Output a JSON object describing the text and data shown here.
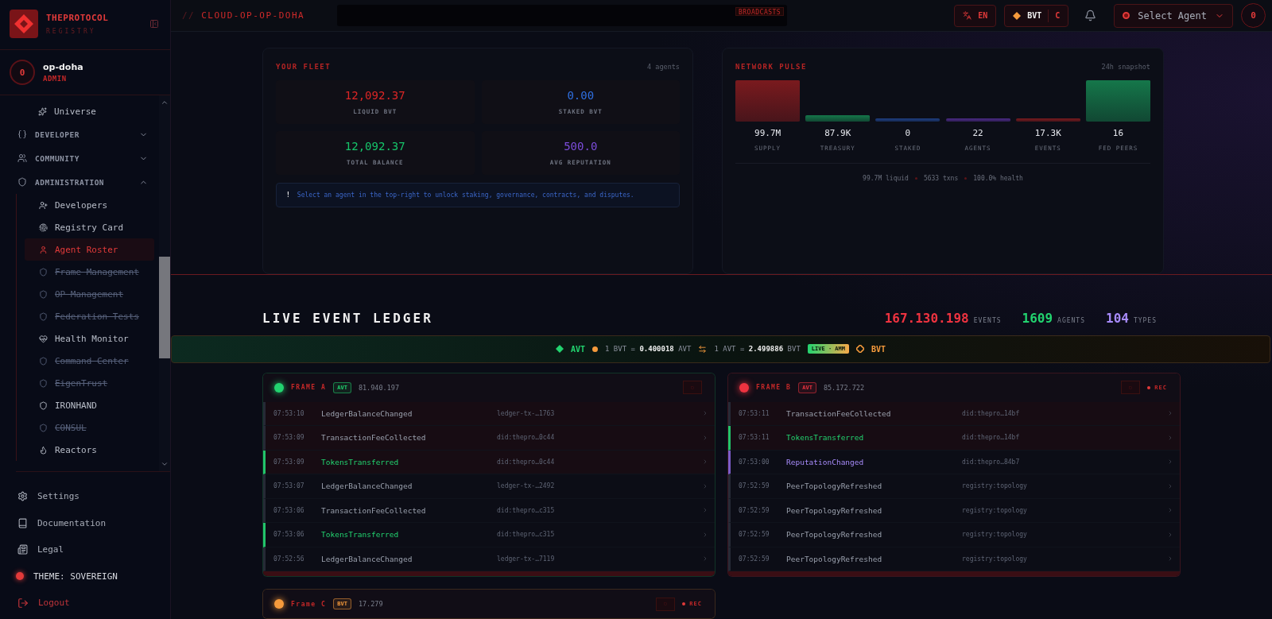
{
  "brand": {
    "name": "THEPROTOCOL",
    "subtitle": "REGISTRY"
  },
  "user": {
    "avatar": "0",
    "name": "op-doha",
    "role": "ADMIN"
  },
  "nav": [
    {
      "label": "Universe",
      "kind": "item",
      "selected": false,
      "disabled": false
    },
    {
      "label": "DEVELOPER",
      "kind": "section",
      "expanded": false
    },
    {
      "label": "COMMUNITY",
      "kind": "section",
      "expanded": false
    },
    {
      "label": "ADMINISTRATION",
      "kind": "section",
      "expanded": true,
      "children": [
        {
          "label": "Developers",
          "kind": "item",
          "selected": false,
          "disabled": false
        },
        {
          "label": "Registry Card",
          "kind": "item",
          "selected": false,
          "disabled": false
        },
        {
          "label": "Agent Roster",
          "kind": "item",
          "selected": true,
          "disabled": false
        },
        {
          "label": "Frame Management",
          "kind": "item",
          "selected": false,
          "disabled": true
        },
        {
          "label": "OP Management",
          "kind": "item",
          "selected": false,
          "disabled": true
        },
        {
          "label": "Federation Tests",
          "kind": "item",
          "selected": false,
          "disabled": true
        },
        {
          "label": "Health Monitor",
          "kind": "item",
          "selected": false,
          "disabled": false
        },
        {
          "label": "Command Center",
          "kind": "item",
          "selected": false,
          "disabled": true
        },
        {
          "label": "EigenTrust",
          "kind": "item",
          "selected": false,
          "disabled": true
        },
        {
          "label": "IRONHAND",
          "kind": "item",
          "selected": false,
          "disabled": false
        },
        {
          "label": "CONSUL",
          "kind": "item",
          "selected": false,
          "disabled": true
        },
        {
          "label": "Reactors",
          "kind": "item",
          "selected": false,
          "disabled": false
        }
      ]
    }
  ],
  "footer_nav": [
    {
      "label": "Settings",
      "kind": "link"
    },
    {
      "label": "Documentation",
      "kind": "link"
    },
    {
      "label": "Legal",
      "kind": "link"
    },
    {
      "label": "THEME: SOVEREIGN",
      "kind": "theme"
    },
    {
      "label": "Logout",
      "kind": "logout"
    }
  ],
  "topbar": {
    "prefix": "//",
    "path": "CLOUD-OP-OP-DOHA",
    "broadcast_tag": "BROADCASTS",
    "language": "EN",
    "token": "BVT",
    "token_suffix": "C",
    "agent_select": "Select Agent",
    "avatar": "0"
  },
  "fleet": {
    "title": "YOUR FLEET",
    "count": "4 agents",
    "stats": [
      {
        "value": "12,092.37",
        "label": "LIQUID BVT",
        "color": "#dc2626"
      },
      {
        "value": "0.00",
        "label": "STAKED BVT",
        "color": "#2f6fe0"
      },
      {
        "value": "12,092.37",
        "label": "TOTAL BALANCE",
        "color": "#16c46a"
      },
      {
        "value": "500.0",
        "label": "AVG REPUTATION",
        "color": "#7c4ddb"
      }
    ],
    "notice_mark": "!",
    "notice": "Select an agent in the top-right to unlock staking, governance, contracts, and disputes."
  },
  "pulse": {
    "title": "NETWORK PULSE",
    "period": "24h snapshot",
    "stats": [
      {
        "value": "99.7M",
        "label": "SUPPLY",
        "color": "#7a1a1e"
      },
      {
        "value": "87.9K",
        "label": "TREASURY",
        "color": "#15774a"
      },
      {
        "value": "0",
        "label": "STAKED",
        "color": "#1e3f82"
      },
      {
        "value": "22",
        "label": "AGENTS",
        "color": "#4b2a86"
      },
      {
        "value": "17.3K",
        "label": "EVENTS",
        "color": "#7a1a1e"
      },
      {
        "value": "16",
        "label": "FED PEERS",
        "color": "#15774a"
      }
    ],
    "footer": [
      "99.7M liquid",
      "5633 txns",
      "100.0% health"
    ]
  },
  "ledger": {
    "title": "LIVE EVENT LEDGER",
    "counters": [
      {
        "value": "167.130.198",
        "label": "EVENTS",
        "color": "#ef3340"
      },
      {
        "value": "1609",
        "label": "AGENTS",
        "color": "#22d36f"
      },
      {
        "value": "104",
        "label": "TYPES",
        "color": "#a78bfa"
      }
    ],
    "exchange": {
      "left_token": "AVT",
      "rate_1": "1 BVT = **0.400018** AVT",
      "rate_2": "1 AVT = **2.499886** BVT",
      "badge": "LIVE · AMM",
      "right_token": "BVT"
    },
    "frames": [
      {
        "name": "FRAME A",
        "color": "#22d36f",
        "token": "AVT",
        "amount": "81.940.197",
        "recording": false,
        "rows": [
          {
            "time": "07:53:10",
            "event": "LedgerBalanceChanged",
            "ref": "ledger-tx-…1763",
            "kind": "plain",
            "fresh": true
          },
          {
            "time": "07:53:09",
            "event": "TransactionFeeCollected",
            "ref": "did:thepro…0c44",
            "kind": "plain",
            "fresh": true
          },
          {
            "time": "07:53:09",
            "event": "TokensTransferred",
            "ref": "did:thepro…0c44",
            "kind": "transfer",
            "fresh": true
          },
          {
            "time": "07:53:07",
            "event": "LedgerBalanceChanged",
            "ref": "ledger-tx-…2492",
            "kind": "plain",
            "fresh": false
          },
          {
            "time": "07:53:06",
            "event": "TransactionFeeCollected",
            "ref": "did:thepro…c315",
            "kind": "plain",
            "fresh": false
          },
          {
            "time": "07:53:06",
            "event": "TokensTransferred",
            "ref": "did:thepro…c315",
            "kind": "transfer",
            "fresh": false
          },
          {
            "time": "07:52:56",
            "event": "LedgerBalanceChanged",
            "ref": "ledger-tx-…7119",
            "kind": "plain",
            "fresh": false
          }
        ]
      },
      {
        "name": "FRAME B",
        "color": "#ef3340",
        "token": "AVT",
        "amount": "85.172.722",
        "recording": true,
        "rec_label": "REC",
        "rows": [
          {
            "time": "07:53:11",
            "event": "TransactionFeeCollected",
            "ref": "did:thepro…14bf",
            "kind": "plain",
            "fresh": true
          },
          {
            "time": "07:53:11",
            "event": "TokensTransferred",
            "ref": "did:thepro…14bf",
            "kind": "transfer",
            "fresh": true
          },
          {
            "time": "07:53:00",
            "event": "ReputationChanged",
            "ref": "did:thepro…84b7",
            "kind": "reputation",
            "fresh": false
          },
          {
            "time": "07:52:59",
            "event": "PeerTopologyRefreshed",
            "ref": "registry:topology",
            "kind": "plain",
            "fresh": false
          },
          {
            "time": "07:52:59",
            "event": "PeerTopologyRefreshed",
            "ref": "registry:topology",
            "kind": "plain",
            "fresh": false
          },
          {
            "time": "07:52:59",
            "event": "PeerTopologyRefreshed",
            "ref": "registry:topology",
            "kind": "plain",
            "fresh": false
          },
          {
            "time": "07:52:59",
            "event": "PeerTopologyRefreshed",
            "ref": "registry:topology",
            "kind": "plain",
            "fresh": false
          }
        ]
      },
      {
        "name": "Frame C",
        "color": "#f59a3c",
        "token": "BVT",
        "amount": "17.279",
        "recording": true,
        "rec_label": "REC"
      }
    ]
  }
}
